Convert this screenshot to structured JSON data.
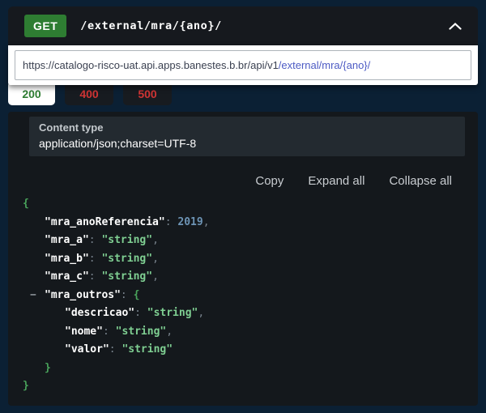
{
  "endpoint": {
    "method": "GET",
    "path": "/external/mra/{ano}/"
  },
  "request_url": {
    "base": "https://catalogo-risco-uat.api.apps.banestes.b.br/api/v1",
    "endpoint_path": "/external/mra/{ano}/"
  },
  "response_tabs": [
    {
      "code": "200",
      "active": true
    },
    {
      "code": "400",
      "active": false
    },
    {
      "code": "500",
      "active": false
    }
  ],
  "content_type": {
    "label": "Content type",
    "value": "application/json;charset=UTF-8"
  },
  "actions": {
    "copy": "Copy",
    "expand_all": "Expand all",
    "collapse_all": "Collapse all"
  },
  "icons": {
    "collapse_section": "chevron-up",
    "collapse_node_marker": "−"
  },
  "response_body": {
    "lines": [
      {
        "indent": 0,
        "tokens": [
          {
            "t": "{",
            "c": "brace"
          }
        ]
      },
      {
        "indent": 1,
        "tokens": [
          {
            "t": "\"mra_anoReferencia\"",
            "c": "key"
          },
          {
            "t": ": ",
            "c": "punct"
          },
          {
            "t": "2019",
            "c": "num"
          },
          {
            "t": ",",
            "c": "punct"
          }
        ]
      },
      {
        "indent": 1,
        "tokens": [
          {
            "t": "\"mra_a\"",
            "c": "key"
          },
          {
            "t": ": ",
            "c": "punct"
          },
          {
            "t": "\"string\"",
            "c": "str"
          },
          {
            "t": ",",
            "c": "punct"
          }
        ]
      },
      {
        "indent": 1,
        "tokens": [
          {
            "t": "\"mra_b\"",
            "c": "key"
          },
          {
            "t": ": ",
            "c": "punct"
          },
          {
            "t": "\"string\"",
            "c": "str"
          },
          {
            "t": ",",
            "c": "punct"
          }
        ]
      },
      {
        "indent": 1,
        "tokens": [
          {
            "t": "\"mra_c\"",
            "c": "key"
          },
          {
            "t": ": ",
            "c": "punct"
          },
          {
            "t": "\"string\"",
            "c": "str"
          },
          {
            "t": ",",
            "c": "punct"
          }
        ]
      },
      {
        "indent": 1,
        "marker": "−",
        "tokens": [
          {
            "t": "\"mra_outros\"",
            "c": "key"
          },
          {
            "t": ": ",
            "c": "punct"
          },
          {
            "t": "{",
            "c": "brace"
          }
        ]
      },
      {
        "indent": 2,
        "tokens": [
          {
            "t": "\"descricao\"",
            "c": "key"
          },
          {
            "t": ": ",
            "c": "punct"
          },
          {
            "t": "\"string\"",
            "c": "str"
          },
          {
            "t": ",",
            "c": "punct"
          }
        ]
      },
      {
        "indent": 2,
        "tokens": [
          {
            "t": "\"nome\"",
            "c": "key"
          },
          {
            "t": ": ",
            "c": "punct"
          },
          {
            "t": "\"string\"",
            "c": "str"
          },
          {
            "t": ",",
            "c": "punct"
          }
        ]
      },
      {
        "indent": 2,
        "tokens": [
          {
            "t": "\"valor\"",
            "c": "key"
          },
          {
            "t": ": ",
            "c": "punct"
          },
          {
            "t": "\"string\"",
            "c": "str"
          }
        ]
      },
      {
        "indent": 1,
        "tokens": [
          {
            "t": "}",
            "c": "brace"
          }
        ]
      },
      {
        "indent": 0,
        "tokens": [
          {
            "t": "}",
            "c": "brace"
          }
        ]
      }
    ]
  },
  "colors": {
    "page_background": "#0b2034",
    "header_background": "#16191e",
    "method_get_green": "#2e7d32",
    "success_tab_green": "#2e7d32",
    "error_tab_red": "#cf3434",
    "url_endpoint_blue": "#4d5bc4",
    "json_key": "#ffffff",
    "json_string_green": "#7fcf92",
    "json_number_blue": "#6d94b5",
    "json_brace_green": "#49a35b",
    "response_panel": "#14181c",
    "content_type_box": "#232a30"
  }
}
